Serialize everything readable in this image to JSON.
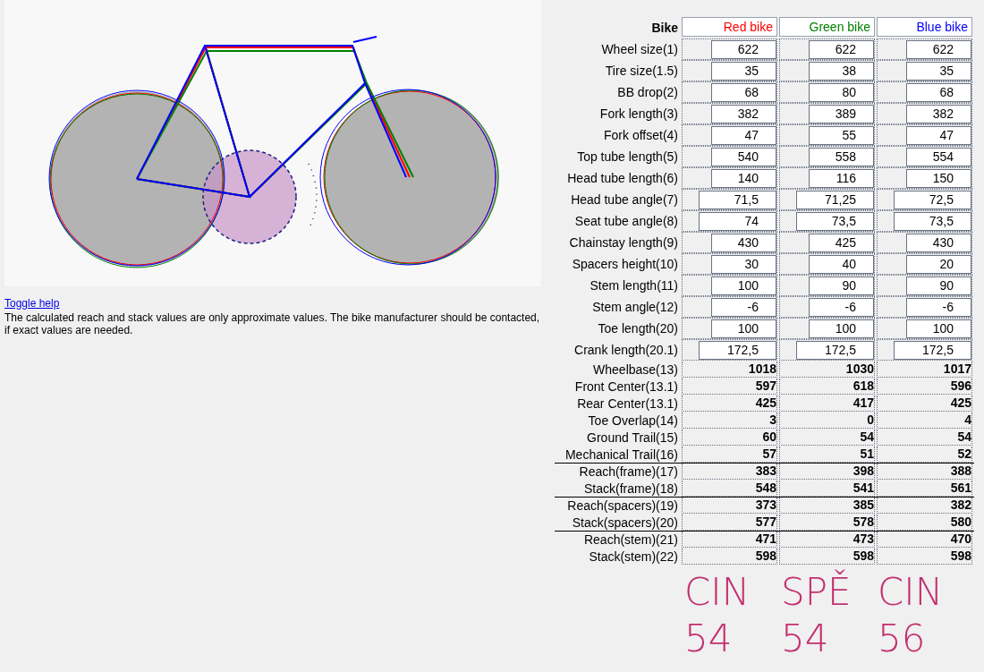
{
  "help": {
    "link": "Toggle help",
    "text": "The calculated reach and stack values are only approximate values. The bike manufacturer should be contacted, if exact values are needed."
  },
  "table": {
    "header_label": "Bike",
    "bikes": [
      {
        "name": "Red bike",
        "color": "#ff0000"
      },
      {
        "name": "Green bike",
        "color": "#008000"
      },
      {
        "name": "Blue bike",
        "color": "#0000ff"
      }
    ],
    "input_rows": [
      {
        "label": "Wheel size(1)",
        "kind": "short",
        "values": [
          "622",
          "622",
          "622"
        ]
      },
      {
        "label": "Tire size(1.5)",
        "kind": "short",
        "values": [
          "35",
          "38",
          "35"
        ]
      },
      {
        "label": "BB drop(2)",
        "kind": "short",
        "values": [
          "68",
          "80",
          "68"
        ]
      },
      {
        "label": "Fork length(3)",
        "kind": "short",
        "values": [
          "382",
          "389",
          "382"
        ]
      },
      {
        "label": "Fork offset(4)",
        "kind": "short",
        "values": [
          "47",
          "55",
          "47"
        ]
      },
      {
        "label": "Top tube length(5)",
        "kind": "short",
        "values": [
          "540",
          "558",
          "554"
        ]
      },
      {
        "label": "Head tube length(6)",
        "kind": "short",
        "values": [
          "140",
          "116",
          "150"
        ]
      },
      {
        "label": "Head tube angle(7)",
        "kind": "wide",
        "values": [
          "71,5",
          "71,25",
          "72,5"
        ]
      },
      {
        "label": "Seat tube angle(8)",
        "kind": "wide",
        "values": [
          "74",
          "73,5",
          "73,5"
        ]
      },
      {
        "label": "Chainstay length(9)",
        "kind": "short",
        "values": [
          "430",
          "425",
          "430"
        ]
      },
      {
        "label": "Spacers height(10)",
        "kind": "short",
        "values": [
          "30",
          "40",
          "20"
        ]
      },
      {
        "label": "Stem length(11)",
        "kind": "short",
        "values": [
          "100",
          "90",
          "90"
        ]
      },
      {
        "label": "Stem angle(12)",
        "kind": "short",
        "values": [
          "-6",
          "-6",
          "-6"
        ]
      },
      {
        "label": "Toe length(20)",
        "kind": "short",
        "values": [
          "100",
          "100",
          "100"
        ]
      },
      {
        "label": "Crank length(20.1)",
        "kind": "wide",
        "values": [
          "172,5",
          "172,5",
          "172,5"
        ]
      }
    ],
    "result_rows": [
      {
        "label": "Wheelbase(13)",
        "separator": false,
        "values": [
          "1018",
          "1030",
          "1017"
        ]
      },
      {
        "label": "Front Center(13.1)",
        "separator": false,
        "values": [
          "597",
          "618",
          "596"
        ]
      },
      {
        "label": "Rear Center(13.1)",
        "separator": false,
        "values": [
          "425",
          "417",
          "425"
        ]
      },
      {
        "label": "Toe Overlap(14)",
        "separator": false,
        "values": [
          "3",
          "0",
          "4"
        ]
      },
      {
        "label": "Ground Trail(15)",
        "separator": false,
        "values": [
          "60",
          "54",
          "54"
        ]
      },
      {
        "label": "Mechanical Trail(16)",
        "separator": false,
        "values": [
          "57",
          "51",
          "52"
        ]
      },
      {
        "label": "Reach(frame)(17)",
        "separator": true,
        "values": [
          "383",
          "398",
          "388"
        ]
      },
      {
        "label": "Stack(frame)(18)",
        "separator": false,
        "values": [
          "548",
          "541",
          "561"
        ]
      },
      {
        "label": "Reach(spacers)(19)",
        "separator": true,
        "values": [
          "373",
          "385",
          "382"
        ]
      },
      {
        "label": "Stack(spacers)(20)",
        "separator": false,
        "values": [
          "577",
          "578",
          "580"
        ]
      },
      {
        "label": "Reach(stem)(21)",
        "separator": true,
        "values": [
          "471",
          "473",
          "470"
        ]
      },
      {
        "label": "Stack(stem)(22)",
        "separator": false,
        "values": [
          "598",
          "598",
          "598"
        ]
      }
    ]
  },
  "handwritten_note": {
    "lines": [
      [
        "CIN",
        "SPĚ",
        "CIN"
      ],
      [
        "54",
        "54",
        "56"
      ]
    ]
  }
}
